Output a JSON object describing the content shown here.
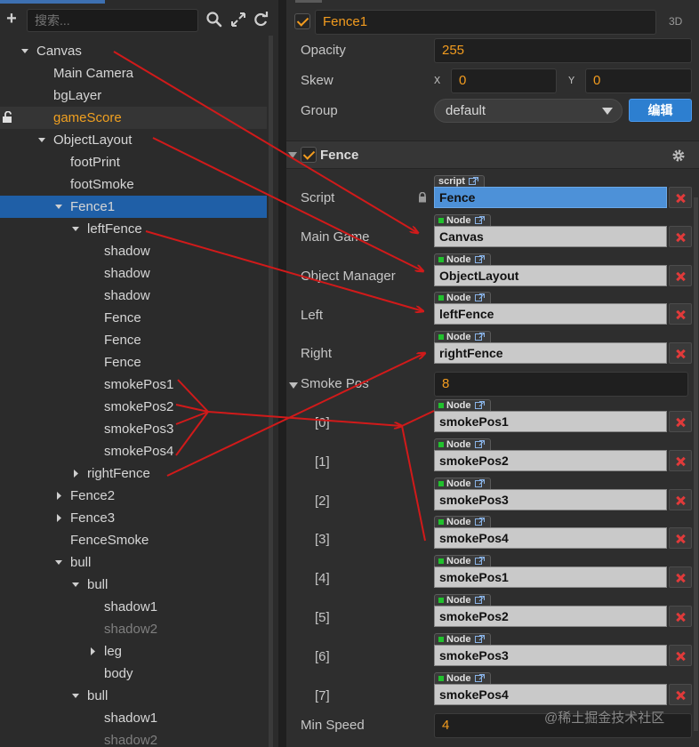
{
  "hierarchy": {
    "search": {
      "placeholder": "搜索..."
    },
    "nodes": [
      {
        "label": "Canvas",
        "arrow": "down",
        "indent": 0
      },
      {
        "label": "Main Camera",
        "arrow": "",
        "indent": 1
      },
      {
        "label": "bgLayer",
        "arrow": "",
        "indent": 1
      },
      {
        "label": "gameScore",
        "arrow": "",
        "indent": 1,
        "state": "locked"
      },
      {
        "label": "ObjectLayout",
        "arrow": "down",
        "indent": 1
      },
      {
        "label": "footPrint",
        "arrow": "",
        "indent": 2
      },
      {
        "label": "footSmoke",
        "arrow": "",
        "indent": 2
      },
      {
        "label": "Fence1",
        "arrow": "down",
        "indent": 2,
        "state": "selected"
      },
      {
        "label": "leftFence",
        "arrow": "down",
        "indent": 3
      },
      {
        "label": "shadow",
        "arrow": "",
        "indent": 4
      },
      {
        "label": "shadow",
        "arrow": "",
        "indent": 4
      },
      {
        "label": "shadow",
        "arrow": "",
        "indent": 4
      },
      {
        "label": "Fence",
        "arrow": "",
        "indent": 4
      },
      {
        "label": "Fence",
        "arrow": "",
        "indent": 4
      },
      {
        "label": "Fence",
        "arrow": "",
        "indent": 4
      },
      {
        "label": "smokePos1",
        "arrow": "",
        "indent": 4
      },
      {
        "label": "smokePos2",
        "arrow": "",
        "indent": 4
      },
      {
        "label": "smokePos3",
        "arrow": "",
        "indent": 4
      },
      {
        "label": "smokePos4",
        "arrow": "",
        "indent": 4
      },
      {
        "label": "rightFence",
        "arrow": "right",
        "indent": 3
      },
      {
        "label": "Fence2",
        "arrow": "right",
        "indent": 2
      },
      {
        "label": "Fence3",
        "arrow": "right",
        "indent": 2
      },
      {
        "label": "FenceSmoke",
        "arrow": "",
        "indent": 2
      },
      {
        "label": "bull",
        "arrow": "down",
        "indent": 2
      },
      {
        "label": "bull",
        "arrow": "down",
        "indent": 3
      },
      {
        "label": "shadow1",
        "arrow": "",
        "indent": 4
      },
      {
        "label": "shadow2",
        "arrow": "",
        "indent": 4,
        "state": "dim"
      },
      {
        "label": "leg",
        "arrow": "right",
        "indent": 4
      },
      {
        "label": "body",
        "arrow": "",
        "indent": 4
      },
      {
        "label": "bull",
        "arrow": "down",
        "indent": 3
      },
      {
        "label": "shadow1",
        "arrow": "",
        "indent": 4
      },
      {
        "label": "shadow2",
        "arrow": "",
        "indent": 4,
        "state": "dim"
      }
    ]
  },
  "inspector": {
    "node_name": "Fence1",
    "three_d_label": "3D",
    "opacity": {
      "label": "Opacity",
      "value": "255"
    },
    "skew": {
      "label": "Skew",
      "x_label": "X",
      "x": "0",
      "y_label": "Y",
      "y": "0"
    },
    "group": {
      "label": "Group",
      "value": "default",
      "edit_label": "编辑"
    },
    "component": {
      "title": "Fence",
      "script": {
        "label": "Script",
        "tag": "script",
        "value": "Fence"
      },
      "main_game": {
        "label": "Main Game",
        "tag": "Node",
        "value": "Canvas"
      },
      "object_manager": {
        "label": "Object Manager",
        "tag": "Node",
        "value": "ObjectLayout"
      },
      "left": {
        "label": "Left",
        "tag": "Node",
        "value": "leftFence"
      },
      "right": {
        "label": "Right",
        "tag": "Node",
        "value": "rightFence"
      },
      "smoke_pos": {
        "label": "Smoke Pos",
        "count": "8",
        "items": [
          {
            "index": "[0]",
            "tag": "Node",
            "value": "smokePos1"
          },
          {
            "index": "[1]",
            "tag": "Node",
            "value": "smokePos2"
          },
          {
            "index": "[2]",
            "tag": "Node",
            "value": "smokePos3"
          },
          {
            "index": "[3]",
            "tag": "Node",
            "value": "smokePos4"
          },
          {
            "index": "[4]",
            "tag": "Node",
            "value": "smokePos1"
          },
          {
            "index": "[5]",
            "tag": "Node",
            "value": "smokePos2"
          },
          {
            "index": "[6]",
            "tag": "Node",
            "value": "smokePos3"
          },
          {
            "index": "[7]",
            "tag": "Node",
            "value": "smokePos4"
          }
        ]
      },
      "min_speed": {
        "label": "Min Speed",
        "value": "4"
      }
    }
  },
  "watermark": "@稀土掘金技术社区",
  "colors": {
    "accent": "#f39c1f",
    "selection": "#1f5fa7",
    "annotation": "#d11a1a",
    "edit_button": "#2d7fd0"
  }
}
